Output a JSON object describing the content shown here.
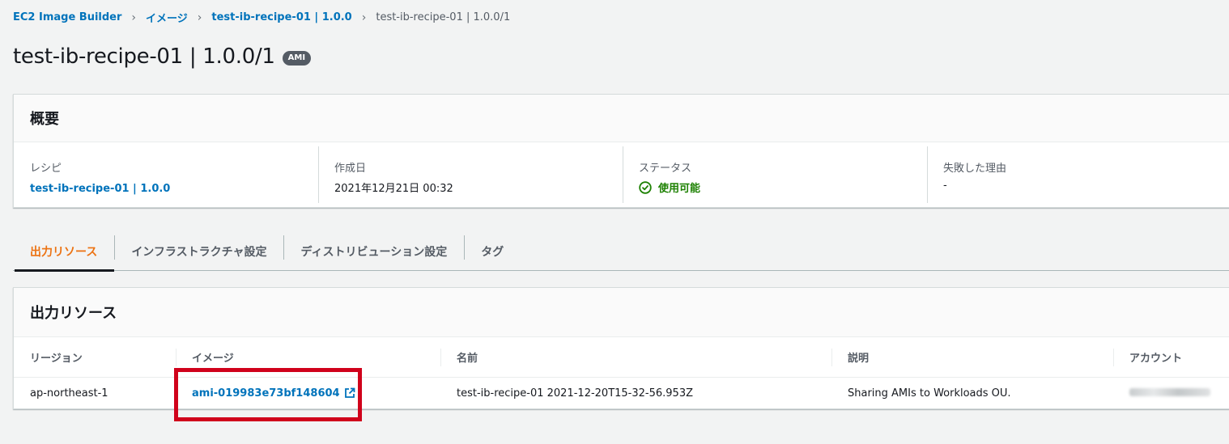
{
  "breadcrumb": {
    "items": [
      "EC2 Image Builder",
      "イメージ",
      "test-ib-recipe-01 | 1.0.0",
      "test-ib-recipe-01 | 1.0.0/1"
    ]
  },
  "header": {
    "title": "test-ib-recipe-01 | 1.0.0/1",
    "badge": "AMI"
  },
  "summary": {
    "title": "概要",
    "recipe": {
      "label": "レシピ",
      "value": "test-ib-recipe-01 | 1.0.0"
    },
    "created": {
      "label": "作成日",
      "value": "2021年12月21日 00:32"
    },
    "status": {
      "label": "ステータス",
      "value": "使用可能",
      "icon": "check-circle-icon",
      "color": "#1d8102"
    },
    "failure": {
      "label": "失敗した理由",
      "value": "-"
    }
  },
  "tabs": [
    {
      "label": "出力リソース",
      "active": true
    },
    {
      "label": "インフラストラクチャ設定",
      "active": false
    },
    {
      "label": "ディストリビューション設定",
      "active": false
    },
    {
      "label": "タグ",
      "active": false
    }
  ],
  "outputs": {
    "title": "出力リソース",
    "columns": [
      "リージョン",
      "イメージ",
      "名前",
      "説明",
      "アカウント"
    ],
    "rows": [
      {
        "region": "ap-northeast-1",
        "image": "ami-019983e73bf148604",
        "name": "test-ib-recipe-01 2021-12-20T15-32-56.953Z",
        "description": "Sharing AMIs to Workloads OU.",
        "account": "(redacted)"
      }
    ]
  },
  "colors": {
    "link": "#0073bb",
    "active_tab": "#ec7211",
    "success": "#1d8102",
    "highlight": "#d0021b"
  }
}
